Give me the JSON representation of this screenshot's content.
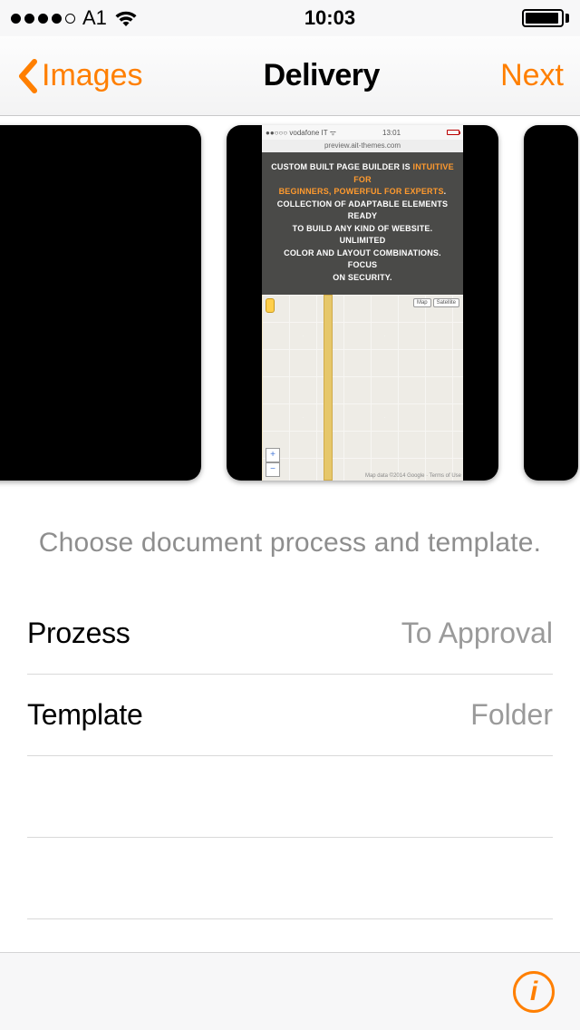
{
  "status_bar": {
    "carrier": "A1",
    "time": "10:03"
  },
  "nav": {
    "back_label": "Images",
    "title": "Delivery",
    "next_label": "Next"
  },
  "preview": {
    "status_carrier": "vodafone IT",
    "status_time": "13:01",
    "url": "preview.ait-themes.com",
    "hero_line1_a": "CUSTOM BUILT PAGE BUILDER IS ",
    "hero_line1_b": "INTUITIVE FOR",
    "hero_line2_a": "BEGINNERS, POWERFUL FOR EXPERTS",
    "hero_line2_b": ".",
    "hero_line3": "COLLECTION OF ADAPTABLE ELEMENTS READY",
    "hero_line4": "TO BUILD ANY KIND OF WEBSITE. UNLIMITED",
    "hero_line5": "COLOR AND LAYOUT COMBINATIONS. FOCUS",
    "hero_line6": "ON SECURITY.",
    "map_btn_map": "Map",
    "map_btn_sat": "Satellite",
    "map_zoom_in": "+",
    "map_zoom_out": "−",
    "map_credit": "Map data ©2014 Google · Terms of Use"
  },
  "form": {
    "instruction": "Choose document process and template.",
    "rows": {
      "process": {
        "label": "Prozess",
        "value": "To Approval"
      },
      "template": {
        "label": "Template",
        "value": "Folder"
      }
    }
  },
  "footer": {
    "info_glyph": "i"
  }
}
